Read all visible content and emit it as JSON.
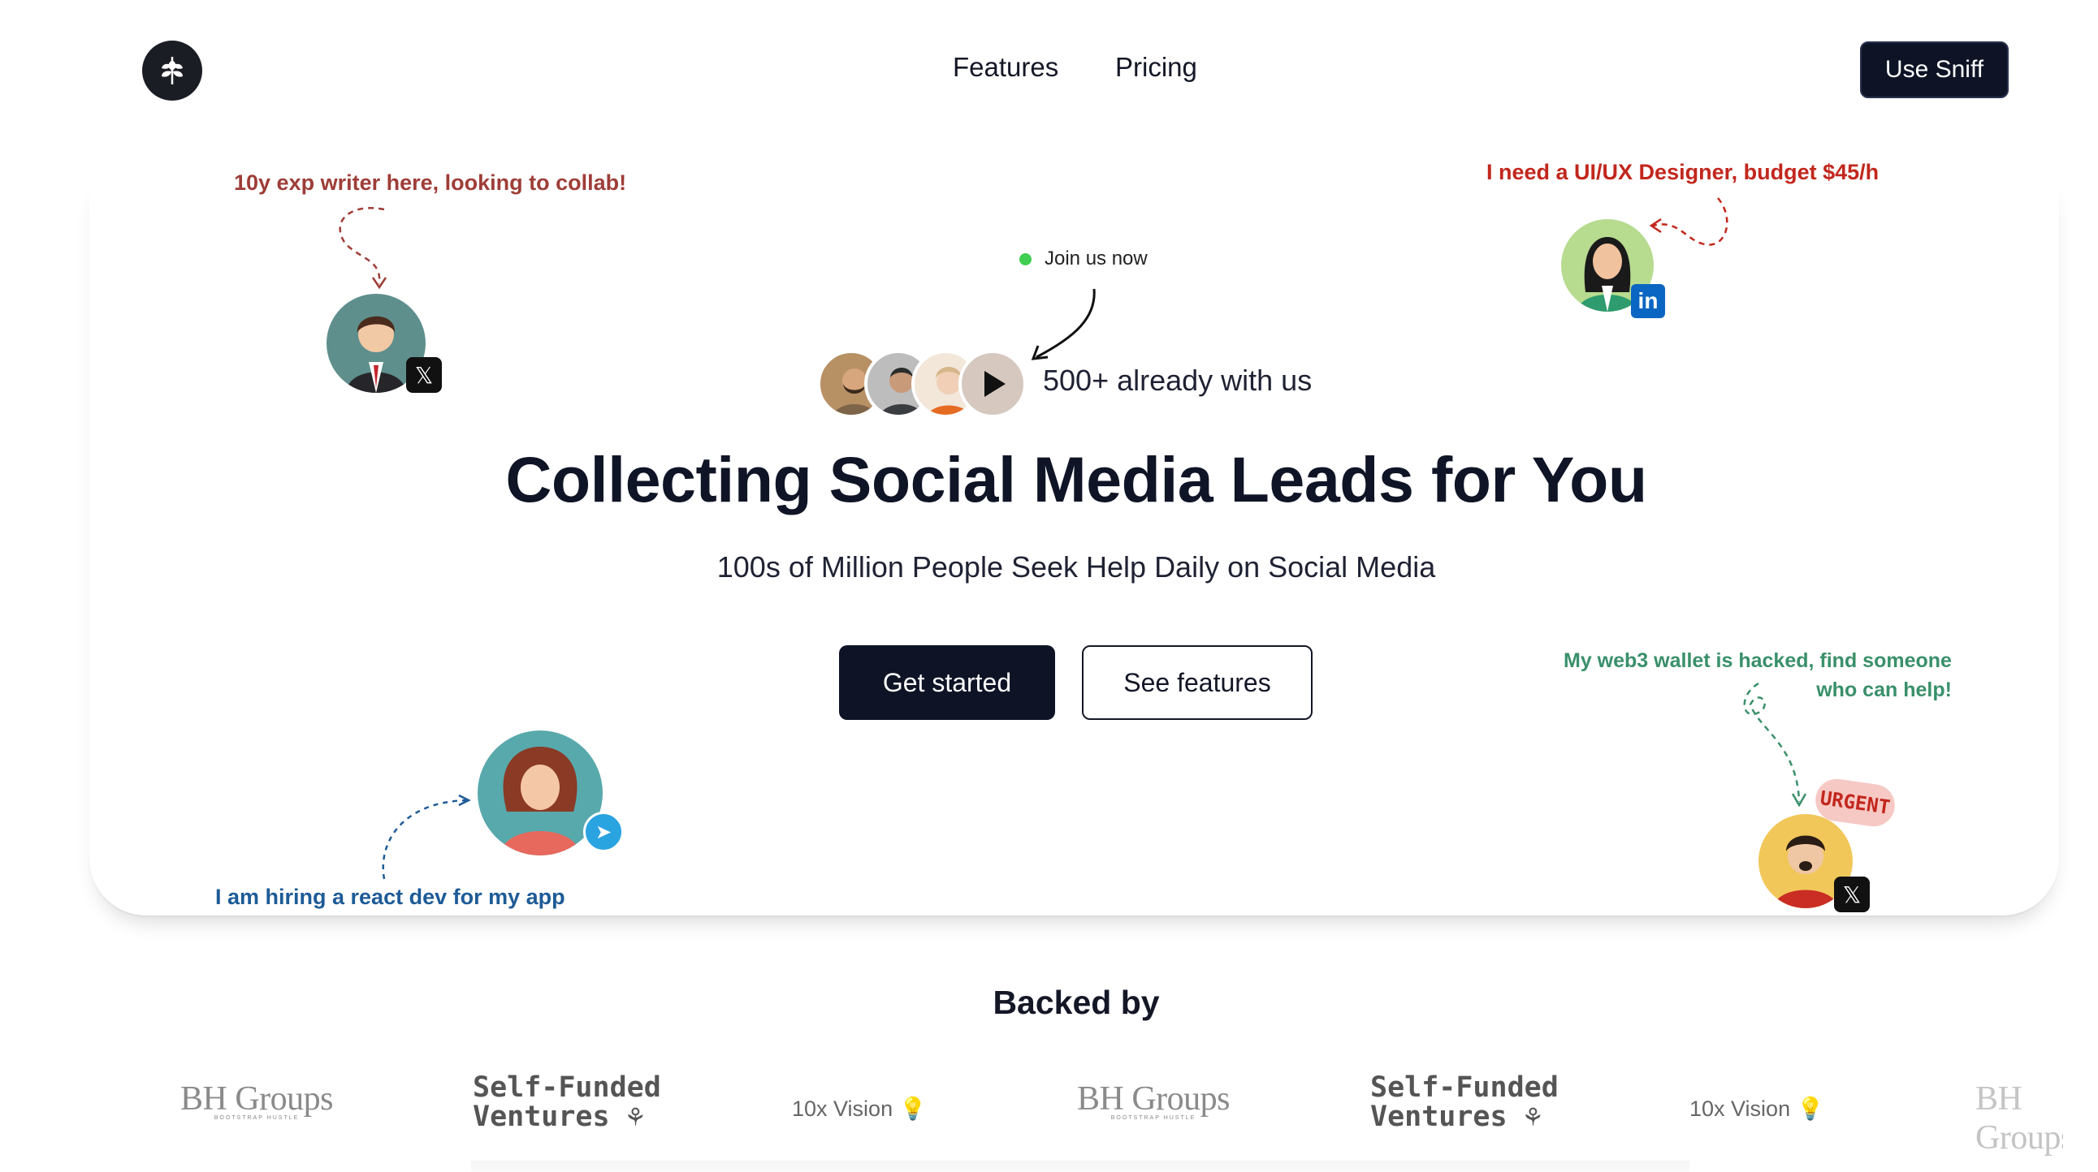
{
  "nav": {
    "links": [
      "Features",
      "Pricing"
    ],
    "cta": "Use Sniff"
  },
  "callouts": {
    "top_left": "10y exp writer here, looking to collab!",
    "top_right": "I need a UI/UX Designer, budget $45/h",
    "bottom_left": "I am hiring a react dev for my app",
    "bottom_right_line1": "My web3 wallet is hacked, find someone",
    "bottom_right_line2": "who can help!",
    "urgent_tag": "URGENT"
  },
  "hero": {
    "join_label": "Join us now",
    "social_proof": "500+ already with us",
    "headline": "Collecting Social Media Leads for You",
    "subheadline": "100s of Million People Seek Help Daily on Social Media",
    "primary_cta": "Get started",
    "secondary_cta": "See features"
  },
  "backed": {
    "title": "Backed by",
    "bh_name": "BH Groups",
    "bh_tag": "BOOTSTRAP HUSTLE",
    "sf_line1": "Self-Funded",
    "sf_line2": "Ventures",
    "tv_name": "10x Vision"
  },
  "colors": {
    "primary": "#0e1426",
    "online_dot": "#3fce51",
    "callout_red": "#c2271d",
    "callout_blue": "#1d5b97",
    "callout_green": "#39906a"
  }
}
